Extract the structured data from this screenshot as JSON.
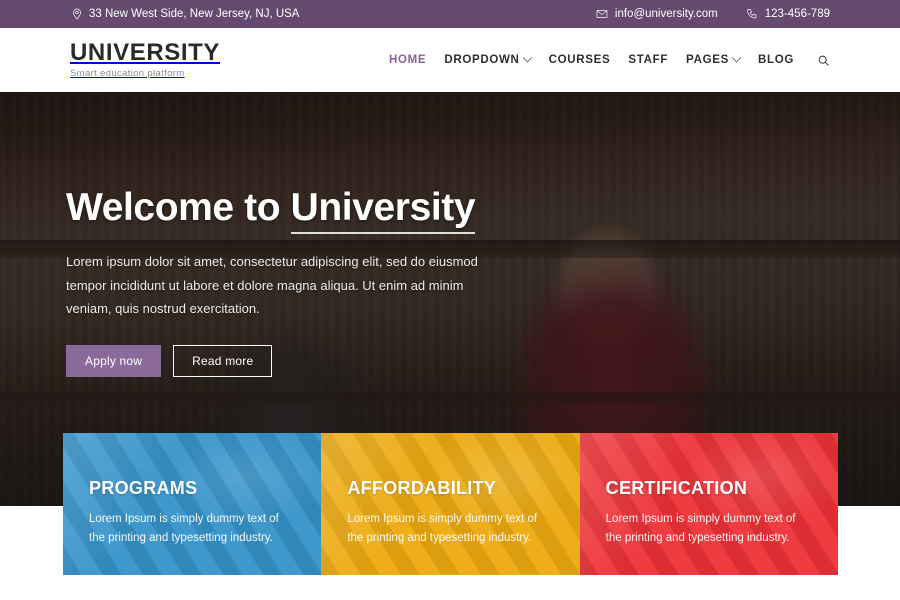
{
  "topbar": {
    "address": "33 New West Side, New Jersey, NJ, USA",
    "address_icon": "location-pin-icon",
    "email": "info@university.com",
    "email_icon": "envelope-icon",
    "phone": "123-456-789",
    "phone_icon": "phone-icon",
    "bg_color": "#654a70"
  },
  "header": {
    "brand_title": "UNIVERSITY",
    "brand_subtitle": "Smart education platform",
    "nav": [
      {
        "label": "HOME",
        "active": true,
        "has_caret": false
      },
      {
        "label": "DROPDOWN",
        "active": false,
        "has_caret": true
      },
      {
        "label": "COURSES",
        "active": false,
        "has_caret": false
      },
      {
        "label": "STAFF",
        "active": false,
        "has_caret": false
      },
      {
        "label": "PAGES",
        "active": false,
        "has_caret": true
      },
      {
        "label": "BLOG",
        "active": false,
        "has_caret": false
      }
    ],
    "search_icon": "search-icon",
    "active_color": "#8a5fa0"
  },
  "hero": {
    "title_prefix": "Welcome to ",
    "title_highlight": "University",
    "paragraph": "Lorem ipsum dolor sit amet, consectetur adipiscing elit, sed do eiusmod tempor incididunt ut labore et dolore magna aliqua. Ut enim ad minim veniam, quis nostrud exercitation.",
    "primary_button": "Apply now",
    "secondary_button": "Read more",
    "primary_color": "#8a6a9a"
  },
  "cards": [
    {
      "title": "PROGRAMS",
      "text": "Lorem Ipsum is simply dummy text of the printing and typesetting industry.",
      "color": "#3592c9"
    },
    {
      "title": "AFFORDABILITY",
      "text": "Lorem Ipsum is simply dummy text of the printing and typesetting industry.",
      "color": "#edaa10"
    },
    {
      "title": "CERTIFICATION",
      "text": "Lorem Ipsum is simply dummy text of the printing and typesetting industry.",
      "color": "#ed3237"
    }
  ]
}
